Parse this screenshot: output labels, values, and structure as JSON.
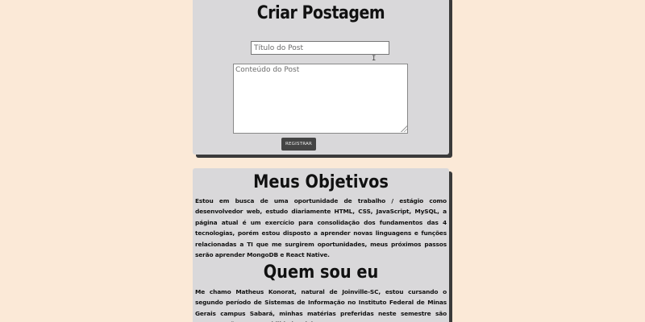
{
  "post_form": {
    "title": "Criar Postagem",
    "title_placeholder": "Título do Post",
    "content_placeholder": "Conteúdo do Post",
    "submit_label": "REGISTRAR"
  },
  "goals": {
    "heading": "Meus Objetivos",
    "text": "Estou em busca de uma oportunidade de trabalho / estágio como desenvolvedor web, estudo diariamente HTML, CSS, JavaScript, MySQL, a página atual é um exercício para consolidação dos fundamentos das 4 tecnologias, porém estou disposto a aprender novas linguagens e funções relacionadas a TI que me surgirem oportunidades, meus próximos passos serão aprender MongoDB e React Native."
  },
  "about": {
    "heading": "Quem sou eu",
    "text": "Me chamo Matheus Konorat, natural de Joinville-SC, estou cursando o segundo período de Sistemas de Informação no Instituto Federal de Minas Gerais campus Sabará, minhas matérias preferidas neste semestre são Programação II e Contabilidade Básica."
  },
  "colors": {
    "page_background": "#fbe9d7",
    "card_background": "#d9d8da",
    "button_background": "#444444"
  },
  "icons": {
    "cursor": "i-beam-cursor-icon",
    "resize": "resize-grip-icon"
  }
}
